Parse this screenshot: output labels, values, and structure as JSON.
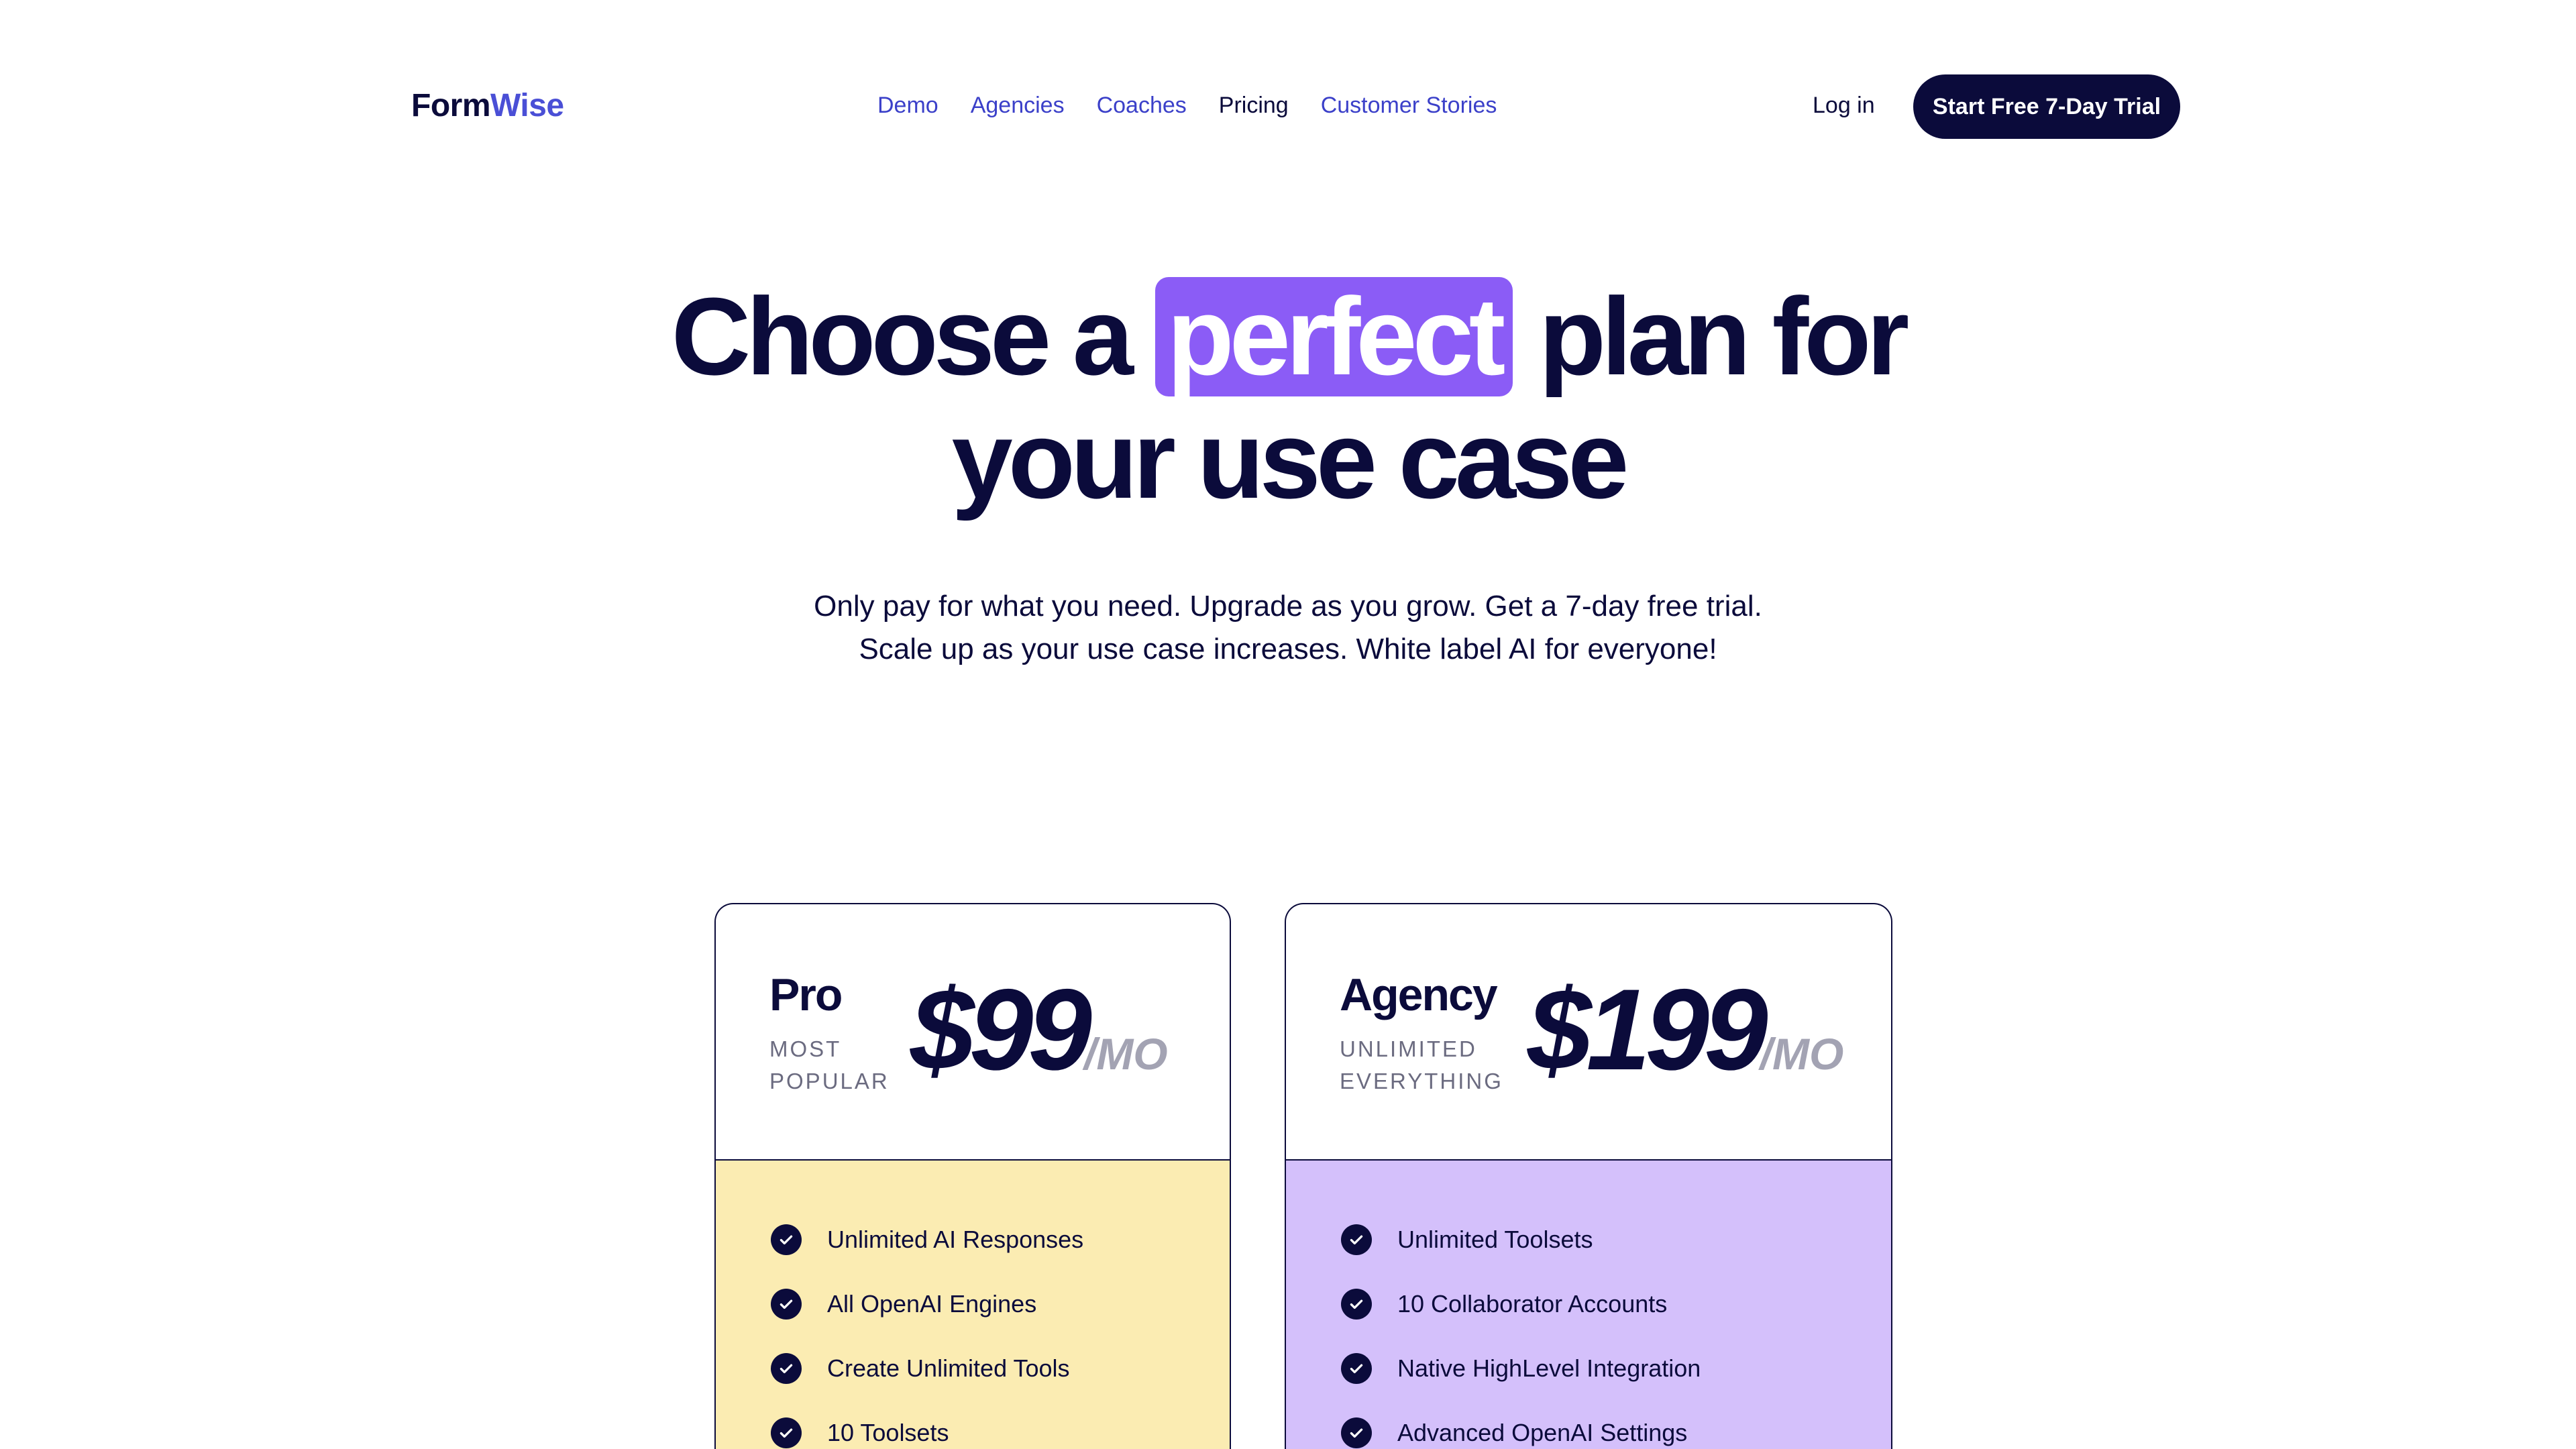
{
  "header": {
    "logo_part1": "Form",
    "logo_part2": "Wise",
    "nav": [
      {
        "label": "Demo"
      },
      {
        "label": "Agencies"
      },
      {
        "label": "Coaches"
      },
      {
        "label": "Pricing",
        "active": true
      },
      {
        "label": "Customer Stories"
      }
    ],
    "login_label": "Log in",
    "cta_label": "Start Free 7-Day Trial"
  },
  "hero": {
    "title_pre": "Choose a",
    "title_highlight": "perfect",
    "title_post": "plan for",
    "title_line2": "your use case",
    "subtitle_line1": "Only pay for what you need. Upgrade as you grow. Get a 7-day free trial.",
    "subtitle_line2": "Scale up as your use case increases. White label AI for everyone!"
  },
  "plans": [
    {
      "name": "Pro",
      "tag_line1": "Most",
      "tag_line2": "Popular",
      "price": "$99",
      "period": "/MO",
      "features": [
        "Unlimited AI Responses",
        "All OpenAI Engines",
        "Create Unlimited Tools",
        "10 Toolsets"
      ]
    },
    {
      "name": "Agency",
      "tag_line1": "Unlimited",
      "tag_line2": "Everything",
      "price": "$199",
      "period": "/MO",
      "features": [
        "Unlimited Toolsets",
        "10 Collaborator Accounts",
        "Native HighLevel Integration",
        "Advanced OpenAI Settings"
      ]
    }
  ],
  "colors": {
    "navy": "#0b0b3b",
    "link_blue": "#3b40c9",
    "highlight_purple": "#8b5cf6",
    "pro_feature_bg": "#fbecb2",
    "agency_feature_bg": "#d4c0fb"
  },
  "icons": {
    "feature_check": "check-circle-icon"
  }
}
